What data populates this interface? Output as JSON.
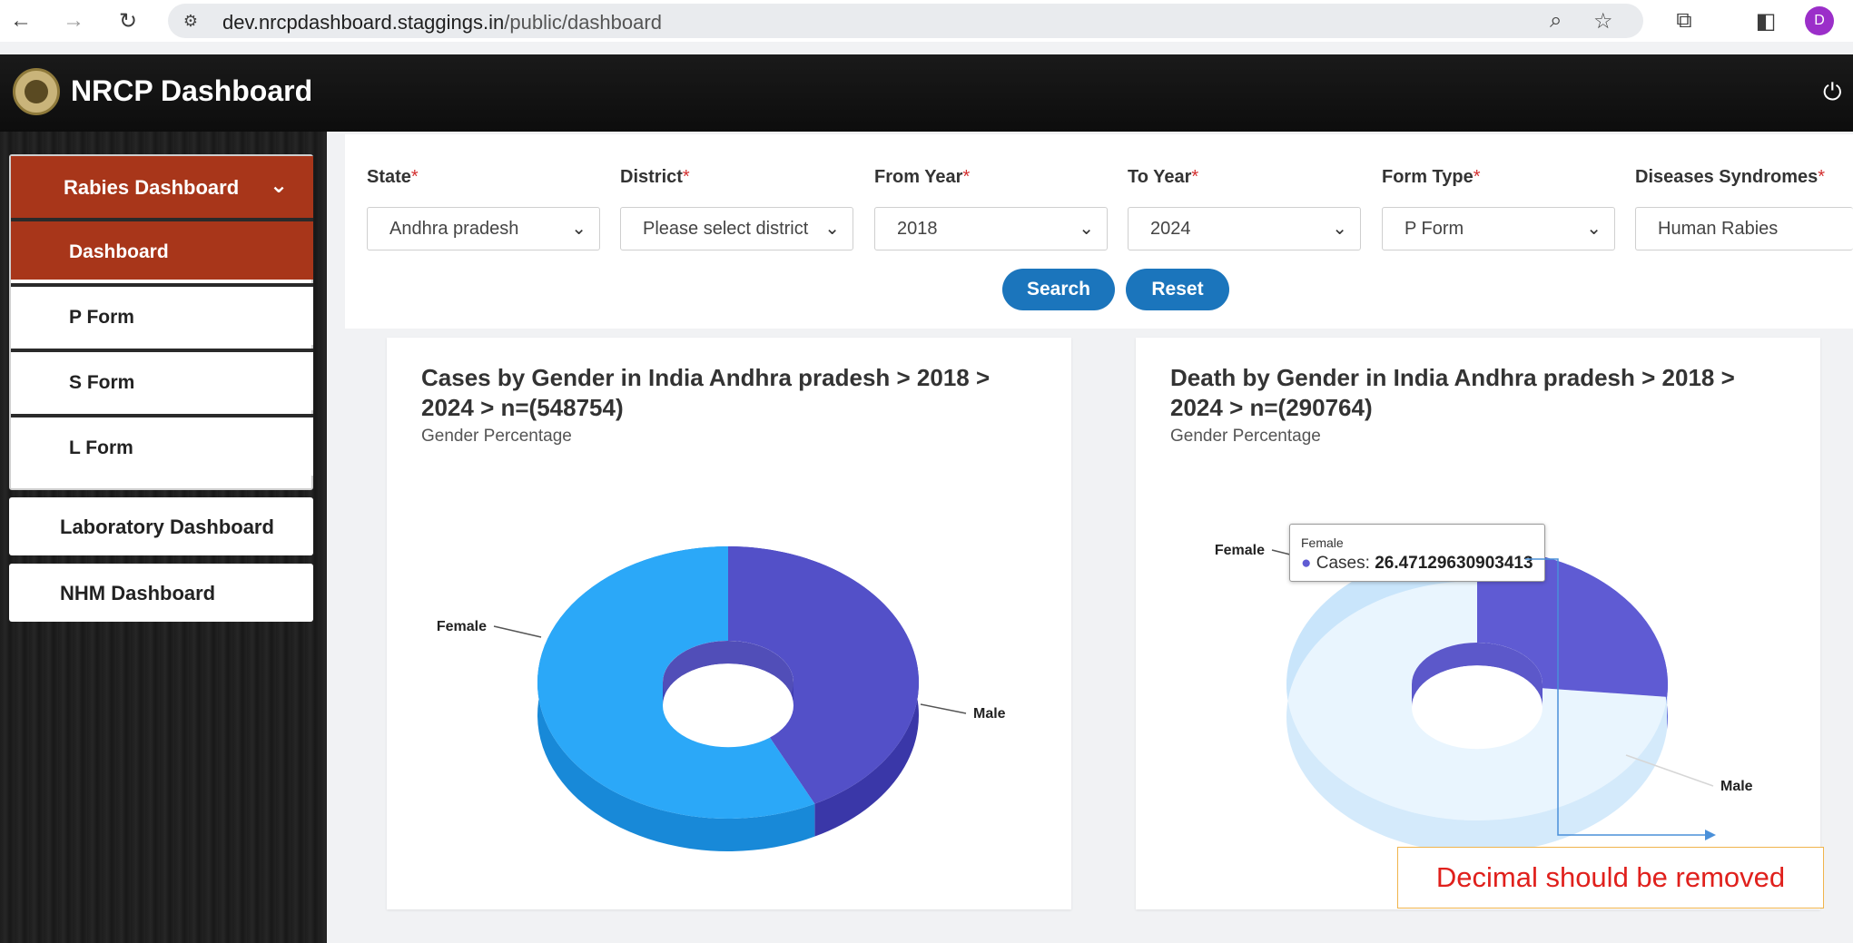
{
  "browser": {
    "url_host": "dev.nrcpdashboard.staggings.in",
    "url_path": "/public/dashboard",
    "profile_initial": "D"
  },
  "header": {
    "title": "NRCP Dashboard"
  },
  "sidebar": {
    "group_title": "Rabies Dashboard",
    "subitems": [
      "Dashboard",
      "P Form",
      "S Form",
      "L Form"
    ],
    "items": [
      "Laboratory Dashboard",
      "NHM Dashboard"
    ]
  },
  "filters": {
    "state": {
      "label": "State",
      "value": "Andhra pradesh"
    },
    "district": {
      "label": "District",
      "value": "Please select district"
    },
    "from_year": {
      "label": "From Year",
      "value": "2018"
    },
    "to_year": {
      "label": "To Year",
      "value": "2024"
    },
    "form_type": {
      "label": "Form Type",
      "value": "P Form"
    },
    "disease": {
      "label": "Diseases Syndromes",
      "value": "Human Rabies"
    },
    "required_mark": "*",
    "search_label": "Search",
    "reset_label": "Reset"
  },
  "colors": {
    "brand_red": "#a8361a",
    "button_blue": "#1b75bc",
    "female": "#5350c8",
    "male": "#2ba8f8",
    "annotation": "#e0201c"
  },
  "chart_data": [
    {
      "type": "pie",
      "title": "Cases by Gender in India Andhra pradesh > 2018 > 2024 > n=(548754)",
      "subtitle": "Gender Percentage",
      "categories": [
        "Female",
        "Male"
      ],
      "values": [
        42.5,
        57.5
      ]
    },
    {
      "type": "pie",
      "title": "Death by Gender in India Andhra pradesh > 2018 > 2024 > n=(290764)",
      "subtitle": "Gender Percentage",
      "categories": [
        "Female",
        "Male"
      ],
      "values": [
        26.47129630903413,
        73.52870369096587
      ],
      "highlighted": "Female"
    }
  ],
  "tooltip": {
    "name": "Female",
    "series": "Cases",
    "value": "26.47129630903413"
  },
  "annotation": {
    "text": "Decimal should be removed"
  }
}
